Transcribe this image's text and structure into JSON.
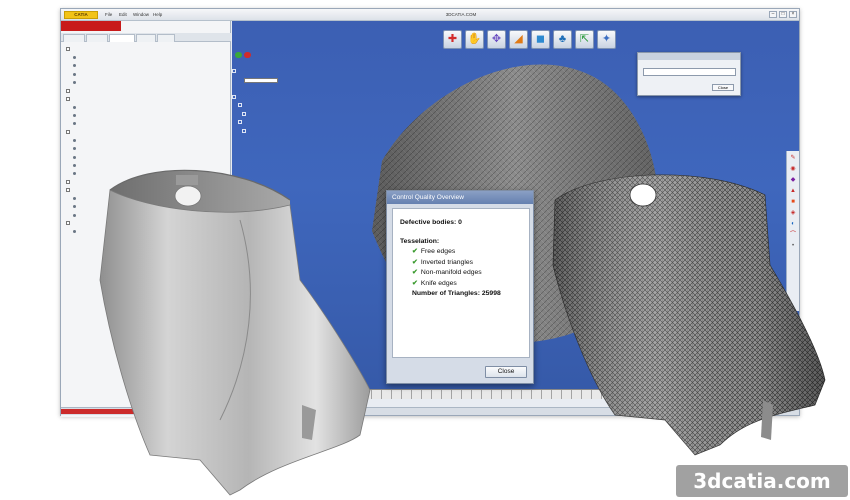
{
  "app": {
    "logo_text": "CATIA",
    "window_title": "3DCATIA.COM",
    "menus": [
      "File",
      "Edit",
      "Window",
      "Help",
      "",
      ""
    ],
    "window_buttons": [
      "–",
      "□",
      "×"
    ]
  },
  "left_panel": {
    "file_tab": "",
    "tabs": [
      "",
      "",
      "",
      "",
      ""
    ],
    "tree": [
      {
        "label": "",
        "kind": "exp"
      },
      {
        "label": "",
        "kind": "bul"
      },
      {
        "label": "",
        "kind": "bul"
      },
      {
        "label": "",
        "kind": "bul"
      },
      {
        "label": "",
        "kind": "bul"
      },
      {
        "label": "",
        "kind": "exp"
      },
      {
        "label": "",
        "kind": "exp"
      },
      {
        "label": "",
        "kind": "bul"
      },
      {
        "label": "",
        "kind": "bul"
      },
      {
        "label": "",
        "kind": "bul"
      },
      {
        "label": "",
        "kind": "exp"
      },
      {
        "label": "",
        "kind": "bul"
      },
      {
        "label": "",
        "kind": "bul"
      },
      {
        "label": "",
        "kind": "bul"
      },
      {
        "label": "",
        "kind": "bul"
      },
      {
        "label": "",
        "kind": "bul"
      },
      {
        "label": "",
        "kind": "exp"
      },
      {
        "label": "",
        "kind": "exp"
      },
      {
        "label": "",
        "kind": "bul"
      },
      {
        "label": "",
        "kind": "bul"
      },
      {
        "label": "",
        "kind": "bul"
      },
      {
        "label": "",
        "kind": "exp"
      },
      {
        "label": "",
        "kind": "bul"
      }
    ]
  },
  "mesh_panel": {
    "title": "",
    "rows": [
      "",
      "",
      "",
      "",
      "",
      "",
      "",
      "",
      "",
      ""
    ]
  },
  "toolbar": {
    "tools": [
      {
        "icon": "home-icon",
        "glyph": "✚"
      },
      {
        "icon": "hand-icon",
        "glyph": "✋"
      },
      {
        "icon": "move-icon",
        "glyph": "✥"
      },
      {
        "icon": "measure-icon",
        "glyph": "◢"
      },
      {
        "icon": "cube-icon",
        "glyph": "◼"
      },
      {
        "icon": "tree-icon",
        "glyph": "♣"
      },
      {
        "icon": "export-icon",
        "glyph": "⇱"
      },
      {
        "icon": "pin-icon",
        "glyph": "✦"
      }
    ]
  },
  "right_tools": [
    "✎",
    "◉",
    "◆",
    "▲",
    "■",
    "◈",
    "◐",
    "⌒",
    "•"
  ],
  "small_dialog": {
    "title": "",
    "close_label": "Close"
  },
  "cq_dialog": {
    "title": "Control Quality Overview",
    "defective_label": "Defective bodies: 0",
    "tessellation_label": "Tesselation:",
    "checks": [
      "Free edges",
      "Inverted triangles",
      "Non-manifold edges",
      "Knife edges"
    ],
    "triangles_label": "Number of Triangles: 25998",
    "close_label": "Close"
  },
  "watermark": "3dcatia.com",
  "colors": {
    "viewport_blue": "#3f67bd",
    "accent_red": "#c81a1a",
    "check_green": "#3a9a2e",
    "mesh_gray": "#3a3a3a"
  }
}
